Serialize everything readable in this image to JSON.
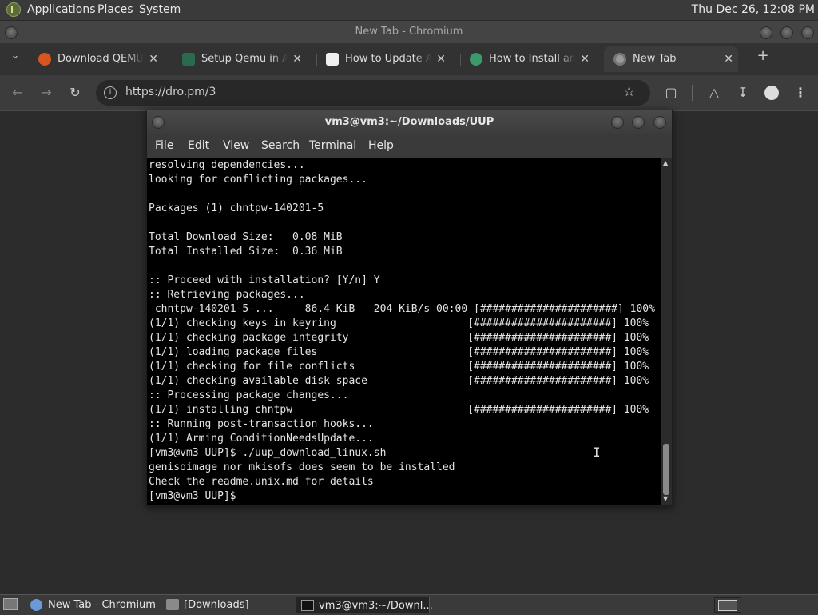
{
  "top_panel": {
    "menus": [
      "Applications",
      "Places",
      "System"
    ],
    "clock": "Thu Dec 26, 12:08 PM"
  },
  "chromium": {
    "title": "New Tab - Chromium",
    "tabs": [
      {
        "label": "Download QEMU -",
        "icon": "qemu-icon",
        "color": "#d9541e"
      },
      {
        "label": "Setup Qemu in Arch",
        "icon": "site-icon",
        "color": "#2a6b4f"
      },
      {
        "label": "How to Update Arch",
        "icon": "site-icon",
        "color": "#f0f0f0"
      },
      {
        "label": "How to Install and",
        "icon": "site-icon",
        "color": "#3a9a6a"
      },
      {
        "label": "New Tab",
        "icon": "chromium-icon",
        "color": "#9a9a9a"
      }
    ],
    "url": "https://dro.pm/3"
  },
  "terminal": {
    "title": "vm3@vm3:~/Downloads/UUP",
    "menu": [
      "File",
      "Edit",
      "View",
      "Search",
      "Terminal",
      "Help"
    ],
    "lines": [
      "resolving dependencies...",
      "looking for conflicting packages...",
      "",
      "Packages (1) chntpw-140201-5",
      "",
      "Total Download Size:   0.08 MiB",
      "Total Installed Size:  0.36 MiB",
      "",
      ":: Proceed with installation? [Y/n] Y",
      ":: Retrieving packages...",
      " chntpw-140201-5-...     86.4 KiB   204 KiB/s 00:00 [######################] 100%",
      "(1/1) checking keys in keyring                     [######################] 100%",
      "(1/1) checking package integrity                   [######################] 100%",
      "(1/1) loading package files                        [######################] 100%",
      "(1/1) checking for file conflicts                  [######################] 100%",
      "(1/1) checking available disk space                [######################] 100%",
      ":: Processing package changes...",
      "(1/1) installing chntpw                            [######################] 100%",
      ":: Running post-transaction hooks...",
      "(1/1) Arming ConditionNeedsUpdate...",
      "[vm3@vm3 UUP]$ ./uup_download_linux.sh",
      "genisoimage nor mkisofs does seem to be installed",
      "Check the readme.unix.md for details",
      "[vm3@vm3 UUP]$ "
    ]
  },
  "taskbar": {
    "tasks": [
      "New Tab - Chromium",
      "[Downloads]",
      "vm3@vm3:~/Downl..."
    ]
  }
}
